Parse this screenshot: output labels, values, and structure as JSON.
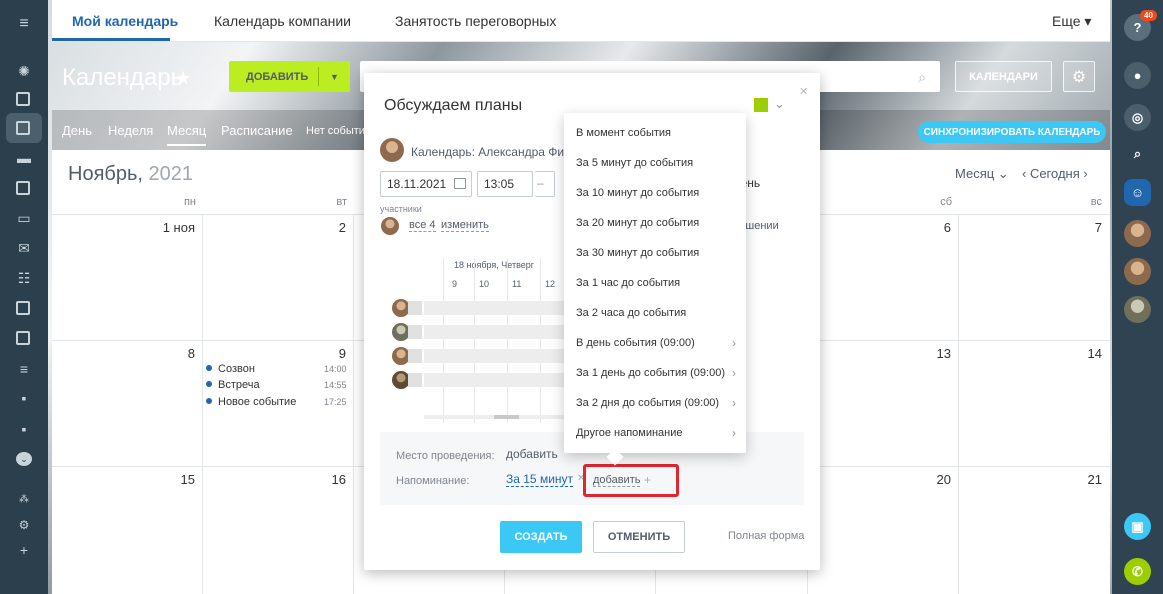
{
  "top_nav": {
    "tabs": [
      "Мой календарь",
      "Календарь компании",
      "Занятость переговорных"
    ],
    "more": "Еще ▾"
  },
  "header": {
    "title": "Календарь",
    "add_label": "ДОБАВИТЬ",
    "calendars_label": "КАЛЕНДАРИ"
  },
  "view_tabs": {
    "items": [
      "День",
      "Неделя",
      "Месяц",
      "Расписание",
      "Нет событи"
    ],
    "sync_label": "СИНХРОНИЗИРОВАТЬ КАЛЕНДАРЬ"
  },
  "calendar": {
    "month": "Ноябрь,",
    "year": "2021",
    "view_select": "Месяц ⌄",
    "today_label": "‹  Сегодня  ›",
    "weekdays": [
      "пн",
      "вт",
      "сб",
      "вс"
    ],
    "days": {
      "d1": "1 ноя",
      "d2": "2",
      "d6": "6",
      "d7": "7",
      "d8": "8",
      "d9": "9",
      "d13": "13",
      "d14": "14",
      "d15": "15",
      "d16": "16",
      "d20": "20",
      "d21": "21"
    },
    "events": [
      {
        "name": "Созвон",
        "time": "14:00"
      },
      {
        "name": "Встреча",
        "time": "14:55"
      },
      {
        "name": "Новое событие",
        "time": "17:25"
      }
    ]
  },
  "popup": {
    "title": "Обсуждаем планы",
    "calendar_name": "Календарь: Александра Фил",
    "date": "18.11.2021",
    "time": "13:05",
    "dash": "–",
    "allday": "ь день",
    "participants_label": "участники",
    "all": "все 4",
    "change": "изменить",
    "solution": "о решении",
    "planner_date": "18 ноября, Четверг",
    "hours": [
      "9",
      "10",
      "11",
      "12"
    ],
    "location_label": "Место проведения:",
    "location_add": "добавить",
    "reminder_label": "Напоминание:",
    "reminder_value": "За 15 минут",
    "reminder_add": "добавить",
    "create_label": "СОЗДАТЬ",
    "cancel_label": "ОТМЕНИТЬ",
    "full_form": "Полная форма"
  },
  "dropdown": {
    "items": [
      "В момент события",
      "За 5 минут до события",
      "За 10 минут до события",
      "За 20 минут до события",
      "За 30 минут до события",
      "За 1 час до события",
      "За 2 часа до события",
      "В день события (09:00)",
      "За 1 день до события (09:00)",
      "За 2 дня до события (09:00)",
      "Другое напоминание"
    ]
  },
  "right_bar": {
    "badge": "40"
  }
}
